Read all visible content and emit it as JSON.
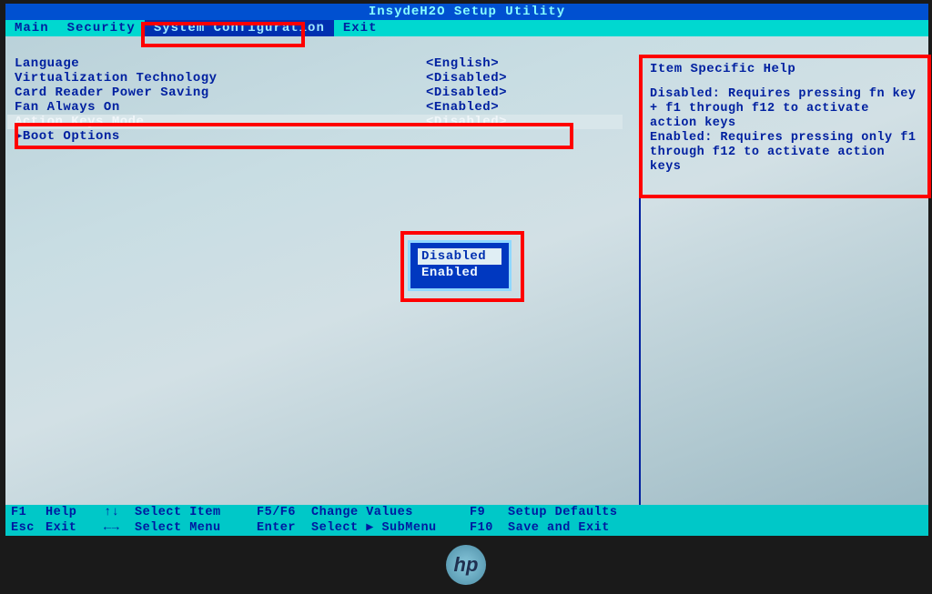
{
  "title": "InsydeH2O Setup Utility",
  "menu": {
    "items": [
      "Main",
      "Security",
      "System Configuration",
      "Exit"
    ],
    "activeIndex": 2
  },
  "settings": [
    {
      "label": "Language",
      "value": "<English>",
      "selected": false
    },
    {
      "label": "Virtualization Technology",
      "value": "<Disabled>",
      "selected": false
    },
    {
      "label": "Card Reader Power Saving",
      "value": "<Disabled>",
      "selected": false
    },
    {
      "label": "Fan Always On",
      "value": "<Enabled>",
      "selected": false
    },
    {
      "label": "Action Keys Mode",
      "value": "<Disabled>",
      "selected": true
    },
    {
      "label": "▶Boot Options",
      "value": "",
      "selected": false
    }
  ],
  "help": {
    "title": "Item Specific Help",
    "text": "Disabled: Requires pressing fn key + f1 through f12 to activate action keys\nEnabled: Requires pressing only f1 through f12 to activate action keys"
  },
  "popup": {
    "options": [
      "Disabled",
      "Enabled"
    ],
    "selectedIndex": 0
  },
  "footer": {
    "rows": [
      [
        {
          "key": "F1",
          "label": "Help"
        },
        {
          "key": "↑↓",
          "label": "Select Item"
        },
        {
          "key": "F5/F6",
          "label": "Change Values"
        },
        {
          "key": "F9",
          "label": "Setup Defaults"
        }
      ],
      [
        {
          "key": "Esc",
          "label": "Exit"
        },
        {
          "key": "←→",
          "label": "Select Menu"
        },
        {
          "key": "Enter",
          "label": "Select ▶ SubMenu"
        },
        {
          "key": "F10",
          "label": "Save and Exit"
        }
      ]
    ]
  },
  "logo": "hp"
}
